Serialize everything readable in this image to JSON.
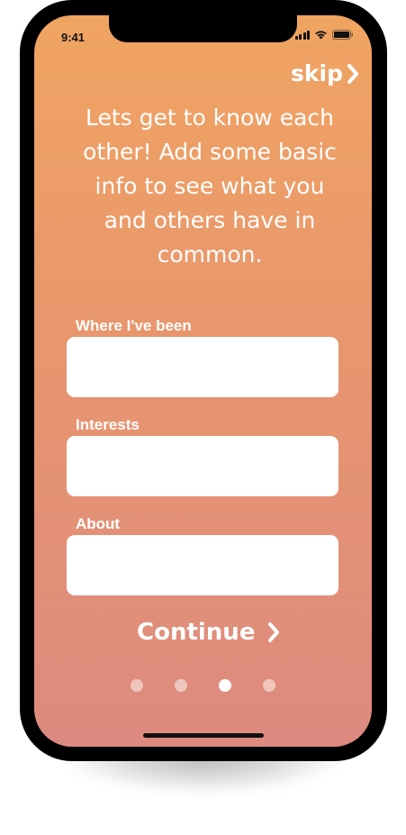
{
  "status_bar": {
    "time": "9:41"
  },
  "header": {
    "skip_label": "skip",
    "skip_icon": "chevron-right-icon"
  },
  "intro": {
    "text": "Lets get to know each other! Add some basic info to see what you and others have in common."
  },
  "form": {
    "fields": [
      {
        "label": "Where I've been",
        "value": ""
      },
      {
        "label": "Interests",
        "value": ""
      },
      {
        "label": "About",
        "value": ""
      }
    ]
  },
  "footer": {
    "continue_label": "Continue",
    "continue_icon": "chevron-right-icon",
    "pagination": {
      "total": 4,
      "current": 3
    }
  },
  "colors": {
    "gradient_top": "#f0a462",
    "gradient_bottom": "#dd8a80",
    "text": "#ffffff",
    "input_background": "#ffffff"
  }
}
